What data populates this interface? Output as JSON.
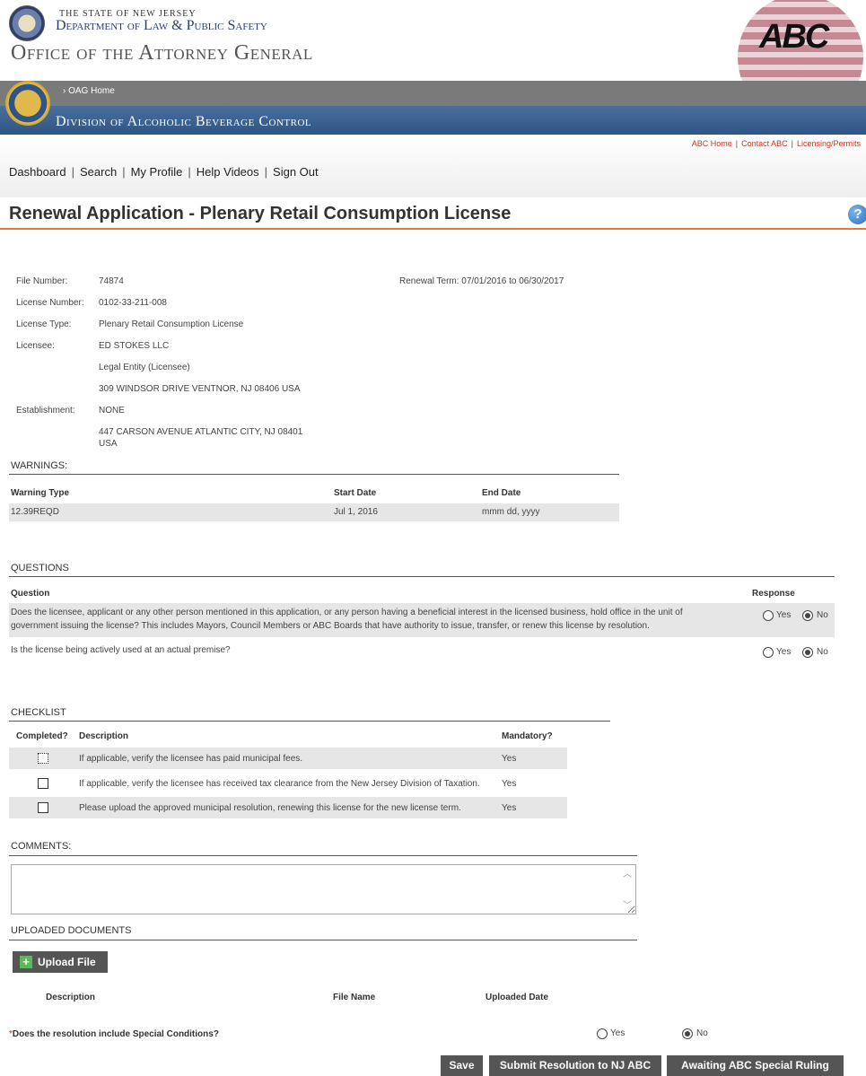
{
  "header": {
    "state_line1": "The State of New Jersey",
    "state_line2": "Department of Law & Public Safety",
    "state_line3": "Office of the Attorney General",
    "oag_home": "OAG Home",
    "division_title": "Division of Alcoholic Beverage Control",
    "logo_text": "ABC"
  },
  "right_links": [
    "ABC Home",
    "Contact ABC",
    "Licensing/Permits"
  ],
  "nav": [
    "Dashboard",
    "Search",
    "My Profile",
    "Help Videos",
    "Sign Out"
  ],
  "page_title": "Renewal Application - Plenary Retail Consumption License",
  "info": {
    "file_number_label": "File Number:",
    "file_number": "74874",
    "renewal_term": "Renewal Term: 07/01/2016 to 06/30/2017",
    "license_number_label": "License Number:",
    "license_number": "0102-33-211-008",
    "license_type_label": "License Type:",
    "license_type": "Plenary Retail Consumption License",
    "licensee_label": "Licensee:",
    "licensee_name": "ED STOKES LLC",
    "licensee_entity": "Legal Entity (Licensee)",
    "licensee_address": "309 WINDSOR DRIVE VENTNOR, NJ 08406 USA",
    "establishment_label": "Establishment:",
    "establishment_name": "NONE",
    "establishment_address1": "447 CARSON AVENUE ATLANTIC CITY, NJ 08401",
    "establishment_address2": "USA"
  },
  "warnings": {
    "heading": "WARNINGS:",
    "headers": [
      "Warning Type",
      "Start Date",
      "End Date"
    ],
    "row": [
      "12.39REQD",
      "Jul 1, 2016",
      "mmm dd, yyyy"
    ]
  },
  "questions": {
    "heading": "QUESTIONS",
    "col_question": "Question",
    "col_response": "Response",
    "q1_line1": "Does the licensee, applicant or any other person mentioned in this application, or any person having a beneficial interest in the licensed business, hold office in the unit of",
    "q1_line2": "government issuing the license? This includes Mayors, Council Members or ABC Boards that have authority to issue, transfer, or renew this license by resolution.",
    "q2": "Is the license being actively used at an actual premise?",
    "yes": "Yes",
    "no": "No"
  },
  "checklist": {
    "heading": "CHECKLIST",
    "headers": [
      "Completed?",
      "Description",
      "Mandatory?"
    ],
    "items": [
      {
        "desc": "If applicable, verify the licensee has paid municipal fees.",
        "mandatory": "Yes"
      },
      {
        "desc": "If applicable, verify the licensee has received tax clearance from the New Jersey Division of Taxation.",
        "mandatory": "Yes"
      },
      {
        "desc": "Please upload the approved municipal resolution, renewing this license for the new license term.",
        "mandatory": "Yes"
      }
    ]
  },
  "comments": {
    "heading": "COMMENTS:"
  },
  "uploaded": {
    "heading": "UPLOADED DOCUMENTS",
    "upload_button": "Upload File",
    "headers": [
      "Description",
      "File Name",
      "Uploaded Date"
    ]
  },
  "special": {
    "asterisk": "*",
    "question": "Does the resolution include Special Conditions?",
    "yes": "Yes",
    "no": "No"
  },
  "buttons": {
    "save": "Save",
    "submit": "Submit Resolution to NJ ABC",
    "awaiting": "Awaiting ABC Special Ruling"
  }
}
